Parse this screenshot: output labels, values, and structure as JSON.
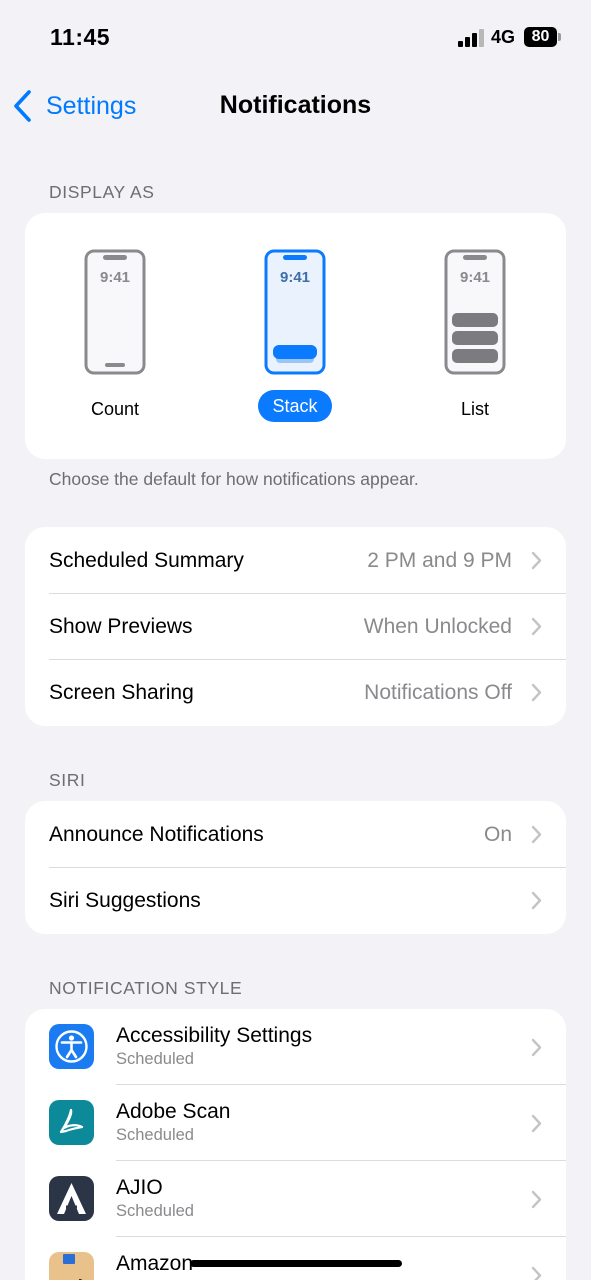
{
  "status_bar": {
    "time": "11:45",
    "network": "4G",
    "battery": "80"
  },
  "nav": {
    "back_label": "Settings",
    "title": "Notifications"
  },
  "display_as": {
    "header": "DISPLAY AS",
    "options": [
      {
        "label": "Count",
        "clock": "9:41",
        "selected": false
      },
      {
        "label": "Stack",
        "clock": "9:41",
        "selected": true
      },
      {
        "label": "List",
        "clock": "9:41",
        "selected": false
      }
    ],
    "footer": "Choose the default for how notifications appear."
  },
  "general": {
    "rows": [
      {
        "label": "Scheduled Summary",
        "value": "2 PM and 9 PM"
      },
      {
        "label": "Show Previews",
        "value": "When Unlocked"
      },
      {
        "label": "Screen Sharing",
        "value": "Notifications Off"
      }
    ]
  },
  "siri": {
    "header": "SIRI",
    "rows": [
      {
        "label": "Announce Notifications",
        "value": "On"
      },
      {
        "label": "Siri Suggestions",
        "value": ""
      }
    ]
  },
  "notification_style": {
    "header": "NOTIFICATION STYLE",
    "apps": [
      {
        "name": "Accessibility Settings",
        "subtitle": "Scheduled",
        "icon": "accessibility-icon",
        "color": "#1a7cf0"
      },
      {
        "name": "Adobe Scan",
        "subtitle": "Scheduled",
        "icon": "adobe-scan-icon",
        "color": "#0d8a9a"
      },
      {
        "name": "AJIO",
        "subtitle": "Scheduled",
        "icon": "ajio-icon",
        "color": "#2b3545"
      },
      {
        "name": "Amazon",
        "subtitle": "",
        "icon": "amazon-icon",
        "color": "#e9c18a"
      }
    ]
  },
  "colors": {
    "accent": "#007aff",
    "background": "#f2f2f7",
    "secondary_text": "#8a8a8e"
  }
}
